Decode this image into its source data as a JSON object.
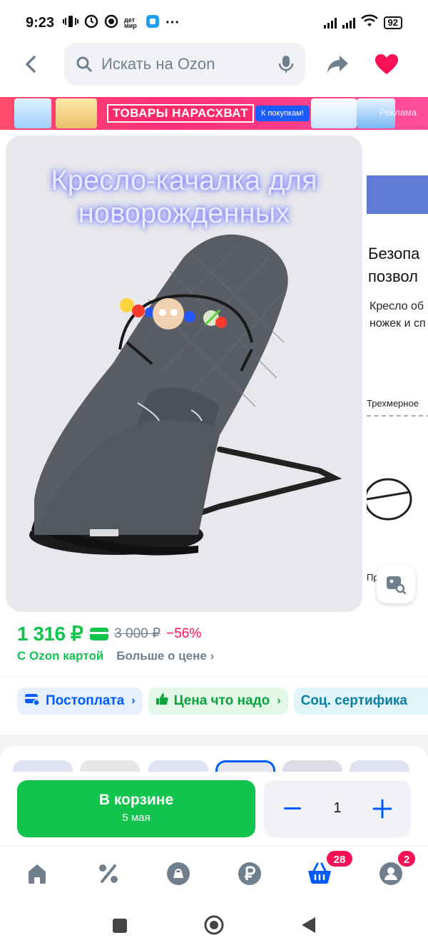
{
  "status_bar": {
    "time": "9:23",
    "battery": "92",
    "dots": "···",
    "app_label": "дет мир"
  },
  "header": {
    "search_placeholder": "Искать на Ozon"
  },
  "banner": {
    "title": "ТОВАРЫ НАРАСХВАТ",
    "cta": "К покупкам!",
    "ad_label": "Реклама"
  },
  "gallery": {
    "overlay_title": "Кресло-качалка для новорожденных",
    "slide2_heading": "Безопа\nпозвол",
    "slide2_text": "Кресло об\nножек и сп",
    "slide2_caption": "Трехмерное",
    "slide2_caption2": "Пр      р-н"
  },
  "price": {
    "current": "1 316 ₽",
    "old": "3 000 ₽",
    "discount": "−56%",
    "card_text": "С Ozon картой",
    "more_text": "Больше о цене"
  },
  "chips": [
    {
      "label": "Постоплата",
      "icon": "card-icon"
    },
    {
      "label": "Цена что надо",
      "icon": "thumbs-up-icon"
    },
    {
      "label": "Соц. сертифика",
      "icon": ""
    }
  ],
  "cart": {
    "label": "В корзине",
    "date": "5 мая",
    "quantity": "1"
  },
  "nav": {
    "cart_badge": "28",
    "profile_badge": "2"
  },
  "colors": {
    "ozon_blue": "#005bff",
    "green": "#10c44c",
    "pink": "#f91155"
  }
}
